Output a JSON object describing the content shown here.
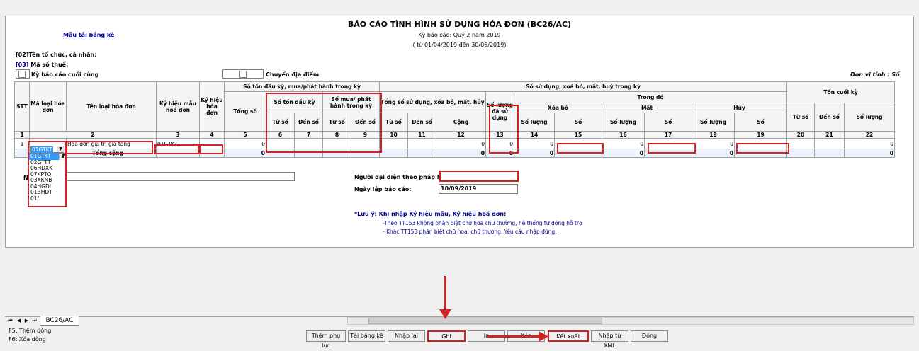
{
  "report": {
    "title": "BÁO CÁO TÌNH HÌNH SỬ DỤNG HÓA ĐƠN (BC26/AC)",
    "period": "Kỳ báo cáo: Quý 2 năm 2019",
    "range": "( từ 01/04/2019 đến 30/06/2019)",
    "template_link": "Mẫu tải bảng kê",
    "org_label": "[02]Tên tổ chức, cá nhân:",
    "tax_label_prefix": "[03]",
    "tax_label": "Mã số thuế:",
    "last_period_label": "Kỳ báo cáo cuối cùng",
    "move_label": "Chuyển địa điểm",
    "unit_label": "Đơn vị tính : Số"
  },
  "table": {
    "h_stt": "STT",
    "h_ma_loai": "Mã loại hóa đơn",
    "h_ten_loai": "Tên loại hóa đơn",
    "h_ky_hieu_mau": "Ký hiệu mẫu hoá đơn",
    "h_ky_hieu_hd": "Ký hiệu hóa đơn",
    "h_ton_dau": "Số tồn đầu kỳ, mua/phát hành trong kỳ",
    "h_tong_so": "Tổng số",
    "h_so_ton_dau": "Số tồn đầu kỳ",
    "h_so_mua": "Số mua/ phát hành trong kỳ",
    "h_tu_so": "Từ số",
    "h_den_so": "Đến số",
    "h_su_dung": "Số sử dụng, xoá bỏ, mất, huỷ trong kỳ",
    "h_tong_su_dung": "Tổng số sử dụng, xóa bỏ, mất, hủy",
    "h_cong": "Cộng",
    "h_so_luong_da_su_dung": "Số lượng đã sử dụng",
    "h_trong_do": "Trong đó",
    "h_xoa_bo": "Xóa bỏ",
    "h_mat": "Mất",
    "h_huy": "Hủy",
    "h_so_luong": "Số lượng",
    "h_so": "Số",
    "h_ton_cuoi": "Tồn cuối kỳ",
    "nums": [
      "1",
      "2",
      "3",
      "4",
      "5",
      "6",
      "7",
      "8",
      "9",
      "10",
      "11",
      "12",
      "13",
      "14",
      "15",
      "16",
      "17",
      "18",
      "19",
      "20",
      "21",
      "22"
    ],
    "row1": {
      "stt": "1",
      "ma_loai": "01GTKT",
      "ten_loai": "Hóa đơn giá trị gia tăng",
      "ky_hieu_mau": "01GTKT",
      "v5": "0",
      "v12": "0",
      "v13": "0",
      "v14": "0",
      "v16": "0",
      "v18": "0",
      "v22": "0"
    },
    "total": {
      "label": "Tổng cộng",
      "v5": "0",
      "v12": "0",
      "v13": "0",
      "v14": "0",
      "v16": "0",
      "v18": "0",
      "v22": "0"
    }
  },
  "dropdown": {
    "options": [
      "01GTKT",
      "02GTTT",
      "06HDXK",
      "07KPTQ",
      "03XKNB",
      "04HGDL",
      "01BHDT",
      "01/"
    ]
  },
  "signature": {
    "rep_label": "Người đại diện theo pháp luật",
    "date_label": "Ngày lập báo cáo:",
    "date_value": "10/09/2019",
    "n_label": "N"
  },
  "note": {
    "title": "*Lưu ý: Khi nhập Ký hiệu mẫu, Ký hiệu hoá đơn:",
    "line1": "-Theo TT153 không phân biệt chữ hoa chữ thường, hệ thống tự động hỗ trợ",
    "line2": "- Khác TT153 phân biệt chữ hoa, chữ thường. Yêu cầu nhập đúng."
  },
  "tabs": {
    "sheet": "BC26/AC"
  },
  "buttons": {
    "them_phu_luc": "Thêm phụ lục",
    "tai_bang_ke": "Tải bảng kê",
    "nhap_lai": "Nhập lại",
    "ghi": "Ghi",
    "in": "In",
    "xoa": "Xóa",
    "ket_xuat": "Kết xuất",
    "nhap_xml": "Nhập từ XML",
    "dong": "Đóng"
  },
  "status": {
    "f5": "F5: Thêm dòng",
    "f6": "F6: Xóa dòng"
  },
  "colors": {
    "highlight": "#d32222",
    "selection": "#3399ff",
    "link": "#00008b"
  }
}
